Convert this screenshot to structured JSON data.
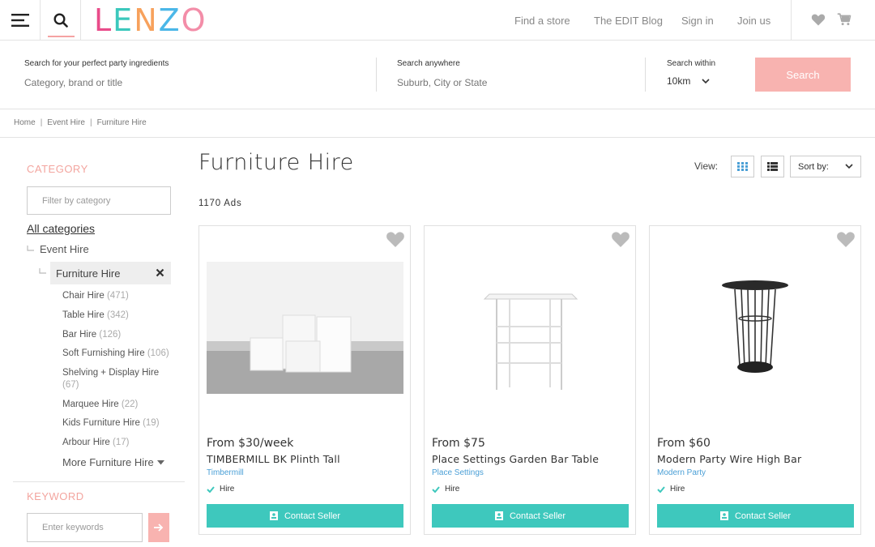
{
  "header": {
    "logo": [
      "L",
      "E",
      "N",
      "Z",
      "O"
    ],
    "nav": {
      "find_store": "Find a store",
      "blog": "The EDIT Blog",
      "sign_in": "Sign in",
      "join": "Join us"
    },
    "icons": [
      "menu-icon",
      "search-icon",
      "heart-icon",
      "cart-icon"
    ]
  },
  "search": {
    "ingredients_label": "Search for your perfect party ingredients",
    "ingredients_placeholder": "Category, brand or title",
    "anywhere_label": "Search anywhere",
    "anywhere_placeholder": "Suburb, City or State",
    "within_label": "Search within",
    "within_value": "10km",
    "button": "Search"
  },
  "breadcrumb": [
    "Home",
    "Event Hire",
    "Furniture Hire"
  ],
  "sidebar": {
    "category_title": "CATEGORY",
    "filter_placeholder": "Filter by category",
    "all_categories": "All categories",
    "parent": "Event Hire",
    "selected": "Furniture Hire",
    "subcategories": [
      {
        "label": "Chair Hire",
        "count": "(471)"
      },
      {
        "label": "Table Hire",
        "count": "(342)"
      },
      {
        "label": "Bar Hire",
        "count": "(126)"
      },
      {
        "label": "Soft Furnishing Hire",
        "count": "(106)"
      },
      {
        "label": "Shelving + Display Hire",
        "count": "(67)"
      },
      {
        "label": "Marquee Hire",
        "count": "(22)"
      },
      {
        "label": "Kids Furniture Hire",
        "count": "(19)"
      },
      {
        "label": "Arbour Hire",
        "count": "(17)"
      }
    ],
    "more": "More Furniture Hire",
    "keyword_title": "KEYWORD",
    "keyword_placeholder": "Enter keywords"
  },
  "main": {
    "title": "Furniture Hire",
    "ad_count": "1170 Ads",
    "view_label": "View:",
    "sort_label": "Sort by:",
    "accent": "#3ec8bd",
    "pink": "#f8b3b0",
    "products": [
      {
        "price": "From $30/week",
        "name": "TIMBERMILL BK Plinth Tall",
        "seller": "Timbermill",
        "tag": "Hire",
        "cta": "Contact Seller"
      },
      {
        "price": "From $75",
        "name": "Place Settings Garden Bar Table",
        "seller": "Place Settings",
        "tag": "Hire",
        "cta": "Contact Seller"
      },
      {
        "price": "From $60",
        "name": "Modern Party Wire High Bar",
        "seller": "Modern Party",
        "tag": "Hire",
        "cta": "Contact Seller"
      }
    ]
  }
}
